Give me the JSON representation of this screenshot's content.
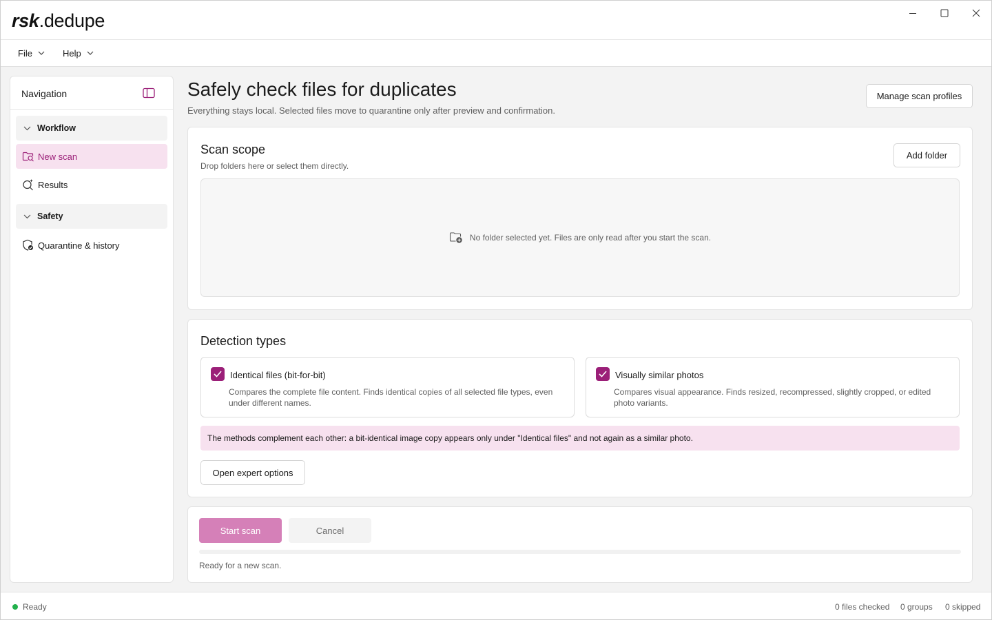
{
  "app": {
    "brand": "rsk",
    "name": ".dedupe"
  },
  "menu": {
    "file": "File",
    "help": "Help"
  },
  "sidebar": {
    "title": "Navigation",
    "groups": [
      {
        "label": "Workflow",
        "items": [
          {
            "label": "New scan",
            "icon": "search-folder-icon",
            "active": true
          },
          {
            "label": "Results",
            "icon": "sparkle-search-icon",
            "active": false
          }
        ]
      },
      {
        "label": "Safety",
        "items": [
          {
            "label": "Quarantine & history",
            "icon": "shield-check-icon",
            "active": false
          }
        ]
      }
    ]
  },
  "main": {
    "title": "Safely check files for duplicates",
    "subtitle": "Everything stays local. Selected files move to quarantine only after preview and confirmation.",
    "manage_profiles": "Manage scan profiles"
  },
  "scope": {
    "title": "Scan scope",
    "subtitle": "Drop folders here or select them directly.",
    "add_folder": "Add folder",
    "empty": "No folder selected yet. Files are only read after you start the scan."
  },
  "detection": {
    "title": "Detection types",
    "options": [
      {
        "title": "Identical files (bit-for-bit)",
        "desc": "Compares the complete file content. Finds identical copies of all selected file types, even under different names.",
        "checked": true
      },
      {
        "title": "Visually similar photos",
        "desc": "Compares visual appearance. Finds resized, recompressed, slightly cropped, or edited photo variants.",
        "checked": true
      }
    ],
    "info": "The methods complement each other: a bit-identical image copy appears only under \"Identical files\" and not again as a similar photo.",
    "expert": "Open expert options"
  },
  "actions": {
    "start": "Start scan",
    "cancel": "Cancel",
    "status": "Ready for a new scan."
  },
  "statusbar": {
    "state": "Ready",
    "files_checked": "0 files checked",
    "groups": "0 groups",
    "skipped": "0 skipped"
  },
  "colors": {
    "accent": "#9b1f78",
    "accent_soft": "#f7e1ef",
    "primary_disabled": "#d580b8",
    "ready_dot": "#22b14c"
  }
}
